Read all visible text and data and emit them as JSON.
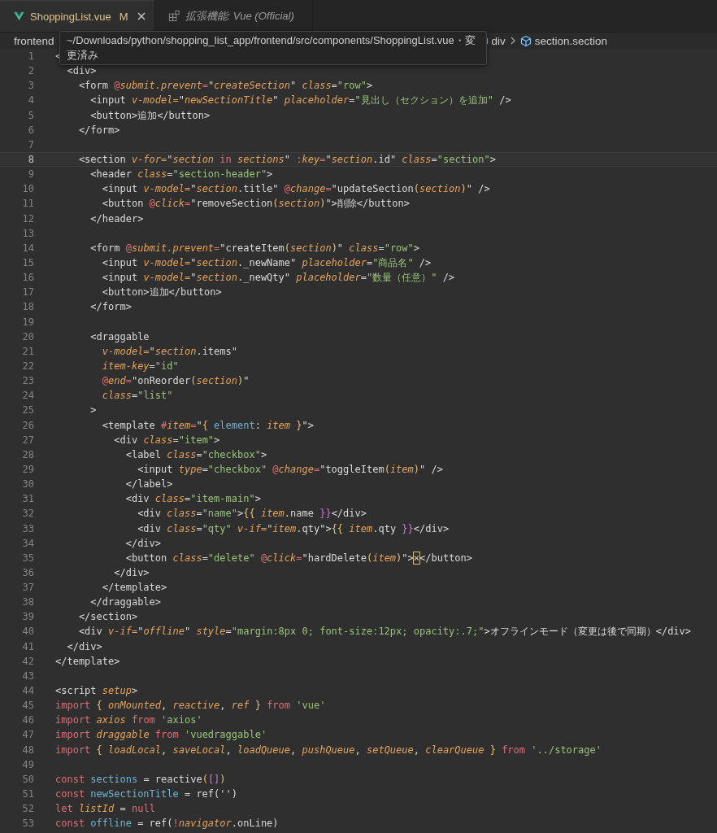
{
  "tabs": [
    {
      "label": "ShoppingList.vue",
      "kind": "vue",
      "badge": "M",
      "selected": true,
      "preview": false,
      "closable": true
    },
    {
      "label": "拡張機能: Vue (Official)",
      "kind": "extension",
      "selected": false,
      "preview": true,
      "closable": false
    }
  ],
  "breadcrumb": [
    {
      "text": "frontend",
      "kind": "folder"
    },
    {
      "text": "div",
      "kind": "element"
    },
    {
      "text": "section.section",
      "kind": "element"
    }
  ],
  "tooltip": {
    "text": "~/Downloads/python/shopping_list_app/frontend/src/components/ShoppingList.vue・変更済み"
  },
  "lines": [
    {
      "number": "1",
      "current": false,
      "tokens": [
        {
          "kind": "plain",
          "text": "<"
        }
      ]
    },
    {
      "number": "2",
      "current": false,
      "tokens": [
        {
          "kind": "plain",
          "text": "  <div>"
        }
      ]
    },
    {
      "number": "3",
      "current": false,
      "tokens": [
        {
          "kind": "plain",
          "text": "    <form "
        },
        {
          "kind": "sigil",
          "text": "@"
        },
        {
          "kind": "attr",
          "text": "submit.prevent"
        },
        {
          "kind": "sigil",
          "text": "="
        },
        {
          "kind": "plain",
          "text": "\""
        },
        {
          "kind": "var",
          "text": "createSection"
        },
        {
          "kind": "plain",
          "text": "\" "
        },
        {
          "kind": "attr",
          "text": "class"
        },
        {
          "kind": "plain",
          "text": "="
        },
        {
          "kind": "string",
          "text": "\"row\""
        },
        {
          "kind": "plain",
          "text": ">"
        }
      ]
    },
    {
      "number": "4",
      "current": false,
      "tokens": [
        {
          "kind": "plain",
          "text": "      <input "
        },
        {
          "kind": "attr",
          "text": "v-model="
        },
        {
          "kind": "plain",
          "text": "\""
        },
        {
          "kind": "var",
          "text": "newSectionTitle"
        },
        {
          "kind": "plain",
          "text": "\" "
        },
        {
          "kind": "attr",
          "text": "placeholder"
        },
        {
          "kind": "plain",
          "text": "="
        },
        {
          "kind": "string",
          "text": "\"見出し（セクション）を追加\""
        },
        {
          "kind": "plain",
          "text": " />"
        }
      ]
    },
    {
      "number": "5",
      "current": false,
      "tokens": [
        {
          "kind": "plain",
          "text": "      <button>追加</button>"
        }
      ]
    },
    {
      "number": "6",
      "current": false,
      "tokens": [
        {
          "kind": "plain",
          "text": "    </form>"
        }
      ]
    },
    {
      "number": "7",
      "current": false
    },
    {
      "number": "8",
      "current": true,
      "tokens": [
        {
          "kind": "plain",
          "text": "    <section "
        },
        {
          "kind": "attr",
          "text": "v-for="
        },
        {
          "kind": "plain",
          "text": "\""
        },
        {
          "kind": "var",
          "text": "section"
        },
        {
          "kind": "keyword",
          "text": " in "
        },
        {
          "kind": "var",
          "text": "sections"
        },
        {
          "kind": "plain",
          "text": "\" "
        },
        {
          "kind": "sigil",
          "text": ":"
        },
        {
          "kind": "attr",
          "text": "key"
        },
        {
          "kind": "sigil",
          "text": "="
        },
        {
          "kind": "plain",
          "text": "\""
        },
        {
          "kind": "var",
          "text": "section"
        },
        {
          "kind": "plain",
          "text": ".id\" "
        },
        {
          "kind": "attr",
          "text": "class"
        },
        {
          "kind": "plain",
          "text": "="
        },
        {
          "kind": "string",
          "text": "\"section\""
        },
        {
          "kind": "plain",
          "text": ">"
        }
      ]
    },
    {
      "number": "9",
      "current": false,
      "tokens": [
        {
          "kind": "plain",
          "text": "      <header "
        },
        {
          "kind": "attr",
          "text": "class"
        },
        {
          "kind": "plain",
          "text": "="
        },
        {
          "kind": "string",
          "text": "\"section-header\""
        },
        {
          "kind": "plain",
          "text": ">"
        }
      ]
    },
    {
      "number": "10",
      "current": false,
      "tokens": [
        {
          "kind": "plain",
          "text": "        <input "
        },
        {
          "kind": "attr",
          "text": "v-model="
        },
        {
          "kind": "plain",
          "text": "\""
        },
        {
          "kind": "var",
          "text": "section"
        },
        {
          "kind": "plain",
          "text": ".title\" "
        },
        {
          "kind": "sigil",
          "text": "@"
        },
        {
          "kind": "attr",
          "text": "change"
        },
        {
          "kind": "sigil",
          "text": "="
        },
        {
          "kind": "plain",
          "text": "\"updateSection"
        },
        {
          "kind": "brace",
          "text": "("
        },
        {
          "kind": "var",
          "text": "section"
        },
        {
          "kind": "brace",
          "text": ")"
        },
        {
          "kind": "plain",
          "text": "\" />"
        }
      ]
    },
    {
      "number": "11",
      "current": false,
      "tokens": [
        {
          "kind": "plain",
          "text": "        <button "
        },
        {
          "kind": "sigil",
          "text": "@"
        },
        {
          "kind": "attr",
          "text": "click"
        },
        {
          "kind": "sigil",
          "text": "="
        },
        {
          "kind": "plain",
          "text": "\"removeSection"
        },
        {
          "kind": "brace",
          "text": "("
        },
        {
          "kind": "var",
          "text": "section"
        },
        {
          "kind": "brace",
          "text": ")"
        },
        {
          "kind": "plain",
          "text": "\">削除</button>"
        }
      ]
    },
    {
      "number": "12",
      "current": false,
      "tokens": [
        {
          "kind": "plain",
          "text": "      </header>"
        }
      ]
    },
    {
      "number": "13",
      "current": false
    },
    {
      "number": "14",
      "current": false,
      "tokens": [
        {
          "kind": "plain",
          "text": "      <form "
        },
        {
          "kind": "sigil",
          "text": "@"
        },
        {
          "kind": "attr",
          "text": "submit.prevent"
        },
        {
          "kind": "sigil",
          "text": "="
        },
        {
          "kind": "plain",
          "text": "\"createItem"
        },
        {
          "kind": "brace",
          "text": "("
        },
        {
          "kind": "var",
          "text": "section"
        },
        {
          "kind": "brace",
          "text": ")"
        },
        {
          "kind": "plain",
          "text": "\" "
        },
        {
          "kind": "attr",
          "text": "class"
        },
        {
          "kind": "plain",
          "text": "="
        },
        {
          "kind": "string",
          "text": "\"row\""
        },
        {
          "kind": "plain",
          "text": ">"
        }
      ]
    },
    {
      "number": "15",
      "current": false,
      "tokens": [
        {
          "kind": "plain",
          "text": "        <input "
        },
        {
          "kind": "attr",
          "text": "v-model="
        },
        {
          "kind": "plain",
          "text": "\""
        },
        {
          "kind": "var",
          "text": "section"
        },
        {
          "kind": "plain",
          "text": "._newName\" "
        },
        {
          "kind": "attr",
          "text": "placeholder"
        },
        {
          "kind": "plain",
          "text": "="
        },
        {
          "kind": "string",
          "text": "\"商品名\""
        },
        {
          "kind": "plain",
          "text": " />"
        }
      ]
    },
    {
      "number": "16",
      "current": false,
      "tokens": [
        {
          "kind": "plain",
          "text": "        <input "
        },
        {
          "kind": "attr",
          "text": "v-model="
        },
        {
          "kind": "plain",
          "text": "\""
        },
        {
          "kind": "var",
          "text": "section"
        },
        {
          "kind": "plain",
          "text": "._newQty\" "
        },
        {
          "kind": "attr",
          "text": "placeholder"
        },
        {
          "kind": "plain",
          "text": "="
        },
        {
          "kind": "string",
          "text": "\"数量（任意）\""
        },
        {
          "kind": "plain",
          "text": " />"
        }
      ]
    },
    {
      "number": "17",
      "current": false,
      "tokens": [
        {
          "kind": "plain",
          "text": "        <button>追加</button>"
        }
      ]
    },
    {
      "number": "18",
      "current": false,
      "tokens": [
        {
          "kind": "plain",
          "text": "      </form>"
        }
      ]
    },
    {
      "number": "19",
      "current": false
    },
    {
      "number": "20",
      "current": false,
      "tokens": [
        {
          "kind": "plain",
          "text": "      <draggable"
        }
      ]
    },
    {
      "number": "21",
      "current": false,
      "tokens": [
        {
          "kind": "attr",
          "text": "        v-model="
        },
        {
          "kind": "plain",
          "text": "\""
        },
        {
          "kind": "var",
          "text": "section"
        },
        {
          "kind": "plain",
          "text": ".items\""
        }
      ]
    },
    {
      "number": "22",
      "current": false,
      "tokens": [
        {
          "kind": "attr",
          "text": "        item-key"
        },
        {
          "kind": "plain",
          "text": "="
        },
        {
          "kind": "string",
          "text": "\"id\""
        }
      ]
    },
    {
      "number": "23",
      "current": false,
      "tokens": [
        {
          "kind": "sigil",
          "text": "        @"
        },
        {
          "kind": "attr",
          "text": "end"
        },
        {
          "kind": "sigil",
          "text": "="
        },
        {
          "kind": "plain",
          "text": "\"onReorder"
        },
        {
          "kind": "brace",
          "text": "("
        },
        {
          "kind": "var",
          "text": "section"
        },
        {
          "kind": "brace",
          "text": ")"
        },
        {
          "kind": "plain",
          "text": "\""
        }
      ]
    },
    {
      "number": "24",
      "current": false,
      "tokens": [
        {
          "kind": "attr",
          "text": "        class"
        },
        {
          "kind": "plain",
          "text": "="
        },
        {
          "kind": "string",
          "text": "\"list\""
        }
      ]
    },
    {
      "number": "25",
      "current": false,
      "tokens": [
        {
          "kind": "plain",
          "text": "      >"
        }
      ]
    },
    {
      "number": "26",
      "current": false,
      "tokens": [
        {
          "kind": "plain",
          "text": "        <template "
        },
        {
          "kind": "sigil",
          "text": "#"
        },
        {
          "kind": "attr",
          "text": "item"
        },
        {
          "kind": "sigil",
          "text": "="
        },
        {
          "kind": "plain",
          "text": "\""
        },
        {
          "kind": "brace",
          "text": "{"
        },
        {
          "kind": "ident",
          "text": " element"
        },
        {
          "kind": "plain",
          "text": ": "
        },
        {
          "kind": "var",
          "text": "item"
        },
        {
          "kind": "brace",
          "text": " }"
        },
        {
          "kind": "plain",
          "text": "\">"
        }
      ]
    },
    {
      "number": "27",
      "current": false,
      "tokens": [
        {
          "kind": "plain",
          "text": "          <div "
        },
        {
          "kind": "attr",
          "text": "class"
        },
        {
          "kind": "plain",
          "text": "="
        },
        {
          "kind": "string",
          "text": "\"item\""
        },
        {
          "kind": "plain",
          "text": ">"
        }
      ]
    },
    {
      "number": "28",
      "current": false,
      "tokens": [
        {
          "kind": "plain",
          "text": "            <label "
        },
        {
          "kind": "attr",
          "text": "class"
        },
        {
          "kind": "plain",
          "text": "="
        },
        {
          "kind": "string",
          "text": "\"checkbox\""
        },
        {
          "kind": "plain",
          "text": ">"
        }
      ]
    },
    {
      "number": "29",
      "current": false,
      "tokens": [
        {
          "kind": "plain",
          "text": "              <input "
        },
        {
          "kind": "attr",
          "text": "type"
        },
        {
          "kind": "plain",
          "text": "="
        },
        {
          "kind": "string",
          "text": "\"checkbox\""
        },
        {
          "kind": "sigil",
          "text": " @"
        },
        {
          "kind": "attr",
          "text": "change"
        },
        {
          "kind": "sigil",
          "text": "="
        },
        {
          "kind": "plain",
          "text": "\"toggleItem"
        },
        {
          "kind": "brace",
          "text": "("
        },
        {
          "kind": "var",
          "text": "item"
        },
        {
          "kind": "brace",
          "text": ")"
        },
        {
          "kind": "plain",
          "text": "\" />"
        }
      ]
    },
    {
      "number": "30",
      "current": false,
      "tokens": [
        {
          "kind": "plain",
          "text": "            </label>"
        }
      ]
    },
    {
      "number": "31",
      "current": false,
      "tokens": [
        {
          "kind": "plain",
          "text": "            <div "
        },
        {
          "kind": "attr",
          "text": "class"
        },
        {
          "kind": "plain",
          "text": "="
        },
        {
          "kind": "string",
          "text": "\"item-main\""
        },
        {
          "kind": "plain",
          "text": ">"
        }
      ]
    },
    {
      "number": "32",
      "current": false,
      "tokens": [
        {
          "kind": "plain",
          "text": "              <div "
        },
        {
          "kind": "attr",
          "text": "class"
        },
        {
          "kind": "plain",
          "text": "="
        },
        {
          "kind": "string",
          "text": "\"name\""
        },
        {
          "kind": "plain",
          "text": ">"
        },
        {
          "kind": "brace",
          "text": "{{"
        },
        {
          "kind": "var",
          "text": " item"
        },
        {
          "kind": "plain",
          "text": ".name "
        },
        {
          "kind": "brace2",
          "text": "}}"
        },
        {
          "kind": "plain",
          "text": "</div>"
        }
      ]
    },
    {
      "number": "33",
      "current": false,
      "tokens": [
        {
          "kind": "plain",
          "text": "              <div "
        },
        {
          "kind": "attr",
          "text": "class"
        },
        {
          "kind": "plain",
          "text": "="
        },
        {
          "kind": "string",
          "text": "\"qty\""
        },
        {
          "kind": "attr",
          "text": " v-if="
        },
        {
          "kind": "plain",
          "text": "\""
        },
        {
          "kind": "var",
          "text": "item"
        },
        {
          "kind": "plain",
          "text": ".qty\">"
        },
        {
          "kind": "brace",
          "text": "{{"
        },
        {
          "kind": "var",
          "text": " item"
        },
        {
          "kind": "plain",
          "text": ".qty "
        },
        {
          "kind": "brace2",
          "text": "}}"
        },
        {
          "kind": "plain",
          "text": "</div>"
        }
      ]
    },
    {
      "number": "34",
      "current": false,
      "tokens": [
        {
          "kind": "plain",
          "text": "            </div>"
        }
      ]
    },
    {
      "number": "35",
      "current": false,
      "tokens": [
        {
          "kind": "plain",
          "text": "            <button "
        },
        {
          "kind": "attr",
          "text": "class"
        },
        {
          "kind": "plain",
          "text": "="
        },
        {
          "kind": "string",
          "text": "\"delete\""
        },
        {
          "kind": "sigil",
          "text": " @"
        },
        {
          "kind": "attr",
          "text": "click"
        },
        {
          "kind": "sigil",
          "text": "="
        },
        {
          "kind": "plain",
          "text": "\"hardDelete"
        },
        {
          "kind": "brace",
          "text": "("
        },
        {
          "kind": "var",
          "text": "item"
        },
        {
          "kind": "brace",
          "text": ")"
        },
        {
          "kind": "plain",
          "text": "\">"
        },
        {
          "kind": "cursor",
          "text": "×"
        },
        {
          "kind": "plain",
          "text": "</button>"
        }
      ]
    },
    {
      "number": "36",
      "current": false,
      "tokens": [
        {
          "kind": "plain",
          "text": "          </div>"
        }
      ]
    },
    {
      "number": "37",
      "current": false,
      "tokens": [
        {
          "kind": "plain",
          "text": "        </template>"
        }
      ]
    },
    {
      "number": "38",
      "current": false,
      "tokens": [
        {
          "kind": "plain",
          "text": "      </draggable>"
        }
      ]
    },
    {
      "number": "39",
      "current": false,
      "tokens": [
        {
          "kind": "plain",
          "text": "    </section>"
        }
      ]
    },
    {
      "number": "40",
      "current": false,
      "tokens": [
        {
          "kind": "plain",
          "text": "    <div "
        },
        {
          "kind": "attr",
          "text": "v-if="
        },
        {
          "kind": "plain",
          "text": "\""
        },
        {
          "kind": "var",
          "text": "offline"
        },
        {
          "kind": "plain",
          "text": "\" "
        },
        {
          "kind": "attr",
          "text": "style"
        },
        {
          "kind": "plain",
          "text": "="
        },
        {
          "kind": "string",
          "text": "\"margin:8px 0; font-size:12px; opacity:.7;\""
        },
        {
          "kind": "plain",
          "text": ">オフラインモード（変更は後で同期）</div>"
        }
      ]
    },
    {
      "number": "41",
      "current": false,
      "tokens": [
        {
          "kind": "plain",
          "text": "  </div>"
        }
      ]
    },
    {
      "number": "42",
      "current": false,
      "tokens": [
        {
          "kind": "plain",
          "text": "</template>"
        }
      ]
    },
    {
      "number": "43",
      "current": false
    },
    {
      "number": "44",
      "current": false,
      "tokens": [
        {
          "kind": "plain",
          "text": "<script "
        },
        {
          "kind": "attr",
          "text": "setup"
        },
        {
          "kind": "plain",
          "text": ">"
        }
      ]
    },
    {
      "number": "45",
      "current": false,
      "tokens": [
        {
          "kind": "keyword",
          "text": "import"
        },
        {
          "kind": "brace",
          "text": " {"
        },
        {
          "kind": "var",
          "text": " onMounted"
        },
        {
          "kind": "plain",
          "text": ", "
        },
        {
          "kind": "var",
          "text": "reactive"
        },
        {
          "kind": "plain",
          "text": ", "
        },
        {
          "kind": "var",
          "text": "ref"
        },
        {
          "kind": "brace",
          "text": " }"
        },
        {
          "kind": "keyword",
          "text": " from"
        },
        {
          "kind": "string",
          "text": " 'vue'"
        }
      ]
    },
    {
      "number": "46",
      "current": false,
      "tokens": [
        {
          "kind": "keyword",
          "text": "import"
        },
        {
          "kind": "var",
          "text": " axios"
        },
        {
          "kind": "keyword",
          "text": " from"
        },
        {
          "kind": "string",
          "text": " 'axios'"
        }
      ]
    },
    {
      "number": "47",
      "current": false,
      "tokens": [
        {
          "kind": "keyword",
          "text": "import"
        },
        {
          "kind": "var",
          "text": " draggable"
        },
        {
          "kind": "keyword",
          "text": " from"
        },
        {
          "kind": "string",
          "text": " 'vuedraggable'"
        }
      ]
    },
    {
      "number": "48",
      "current": false,
      "tokens": [
        {
          "kind": "keyword",
          "text": "import"
        },
        {
          "kind": "brace",
          "text": " {"
        },
        {
          "kind": "var",
          "text": " loadLocal"
        },
        {
          "kind": "plain",
          "text": ", "
        },
        {
          "kind": "var",
          "text": "saveLocal"
        },
        {
          "kind": "plain",
          "text": ", "
        },
        {
          "kind": "var",
          "text": "loadQueue"
        },
        {
          "kind": "plain",
          "text": ", "
        },
        {
          "kind": "var",
          "text": "pushQueue"
        },
        {
          "kind": "plain",
          "text": ", "
        },
        {
          "kind": "var",
          "text": "setQueue"
        },
        {
          "kind": "plain",
          "text": ", "
        },
        {
          "kind": "var",
          "text": "clearQueue"
        },
        {
          "kind": "brace",
          "text": " }"
        },
        {
          "kind": "keyword",
          "text": " from"
        },
        {
          "kind": "string",
          "text": " '../storage'"
        }
      ]
    },
    {
      "number": "49",
      "current": false
    },
    {
      "number": "50",
      "current": false,
      "tokens": [
        {
          "kind": "keyword",
          "text": "const"
        },
        {
          "kind": "ident",
          "text": " sections"
        },
        {
          "kind": "plain",
          "text": " = reactive"
        },
        {
          "kind": "brace",
          "text": "("
        },
        {
          "kind": "brace2",
          "text": "[]"
        },
        {
          "kind": "brace",
          "text": ")"
        }
      ]
    },
    {
      "number": "51",
      "current": false,
      "tokens": [
        {
          "kind": "keyword",
          "text": "const"
        },
        {
          "kind": "ident",
          "text": " newSectionTitle"
        },
        {
          "kind": "plain",
          "text": " = ref('')"
        }
      ]
    },
    {
      "number": "52",
      "current": false,
      "tokens": [
        {
          "kind": "keyword",
          "text": "let"
        },
        {
          "kind": "var",
          "text": " listId"
        },
        {
          "kind": "plain",
          "text": " = "
        },
        {
          "kind": "keyword",
          "text": "null"
        }
      ]
    },
    {
      "number": "53",
      "current": false,
      "tokens": [
        {
          "kind": "keyword",
          "text": "const"
        },
        {
          "kind": "ident",
          "text": " offline"
        },
        {
          "kind": "plain",
          "text": " = ref("
        },
        {
          "kind": "keyword",
          "text": "!"
        },
        {
          "kind": "var",
          "text": "navigator"
        },
        {
          "kind": "plain",
          "text": ".onLine)"
        }
      ]
    }
  ]
}
